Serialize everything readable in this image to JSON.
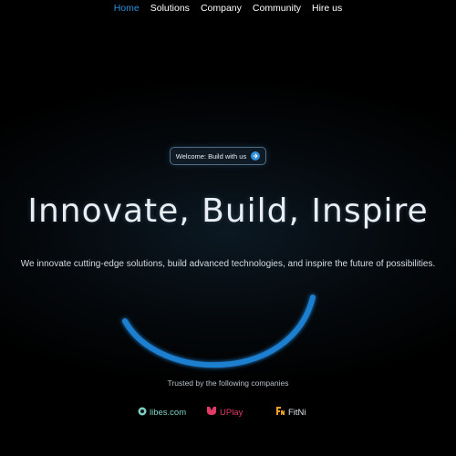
{
  "nav": {
    "items": [
      {
        "label": "Home",
        "active": true
      },
      {
        "label": "Solutions",
        "active": false
      },
      {
        "label": "Company",
        "active": false
      },
      {
        "label": "Community",
        "active": false
      },
      {
        "label": "Hire us",
        "active": false
      }
    ]
  },
  "hero": {
    "badge_label": "Welcome: Build with us",
    "badge_icon": "arrow-right-icon",
    "title": "Innovate, Build, Inspire",
    "subtitle": "We innovate cutting-edge solutions, build advanced technologies, and inspire the future of possibilities."
  },
  "trusted": {
    "label": "Trusted by the following companies",
    "companies": [
      {
        "name": "libes.com",
        "color": "#7fd0c2",
        "icon": "libes-logo-icon"
      },
      {
        "name": "UPlay",
        "color": "#e23a66",
        "icon": "uplay-logo-icon"
      },
      {
        "name": "FitNi",
        "color": "#f2a02a",
        "icon": "fitni-logo-icon"
      }
    ]
  },
  "colors": {
    "accent": "#2f8fd8",
    "arc": "#1f7fd0",
    "background": "#000000"
  }
}
